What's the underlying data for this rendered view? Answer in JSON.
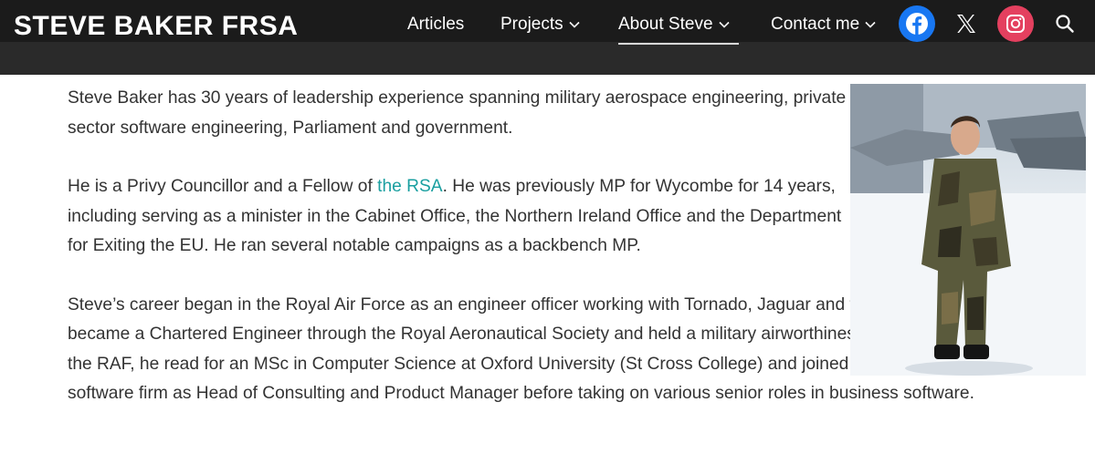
{
  "header": {
    "site_title": "STEVE BAKER FRSA",
    "nav": [
      {
        "label": "Articles",
        "has_dropdown": false,
        "active": false
      },
      {
        "label": "Projects",
        "has_dropdown": true,
        "active": false
      },
      {
        "label": "About Steve",
        "has_dropdown": true,
        "active": true
      },
      {
        "label": "Contact me",
        "has_dropdown": true,
        "active": false
      }
    ],
    "social": [
      {
        "icon": "facebook-icon",
        "color": "#1877f2"
      },
      {
        "icon": "x-icon",
        "color": "#1b1b1b"
      },
      {
        "icon": "instagram-icon",
        "color": "#e4405f"
      }
    ],
    "search_icon": "search-icon"
  },
  "content": {
    "p1": "Steve Baker has 30 years of leadership experience spanning military aerospace engineering, private sector software engineering, Parliament and government.",
    "p2_before": "He is a Privy Councillor and a Fellow of ",
    "p2_link": "the RSA",
    "p2_after": ". He was previously MP for Wycombe for 14 years, including serving as a minister in the Cabinet Office, the Northern Ireland Office and the Department for Exiting the EU. He ran several notable campaigns as a backbench MP.",
    "p3": "Steve’s career began in the Royal Air Force as an engineer officer working with Tornado, Jaguar and the Adour aero engine. He became a Chartered Engineer through the Royal Aeronautical Society and held a military airworthiness licence. After his time with the RAF, he read for an MSc in Computer Science at Oxford University (St Cross College) and joined a specialist, entrepreneurial software firm as Head of Consulting and Product Manager before taking on various senior roles in business software.",
    "link_color": "#1a9fa0"
  },
  "photo": {
    "subject": "portrait-photo"
  }
}
